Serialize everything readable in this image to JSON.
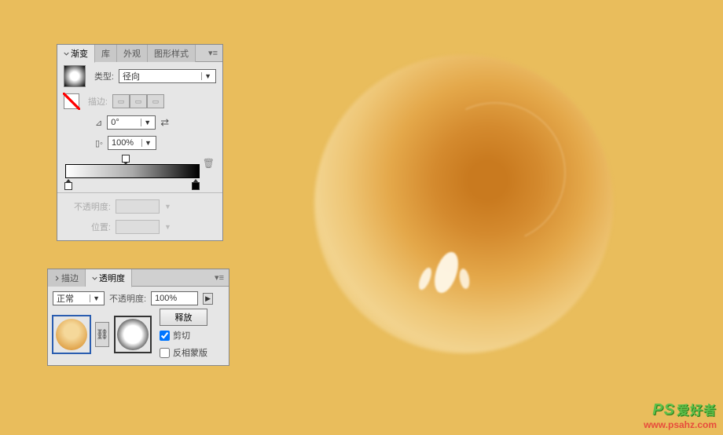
{
  "gradient_panel": {
    "tabs": [
      "渐变",
      "库",
      "外观",
      "图形样式"
    ],
    "active_tab": "渐变",
    "type_label": "类型:",
    "type_value": "径向",
    "stroke_label": "描边:",
    "angle_value": "0°",
    "ratio_value": "100%",
    "opacity_label": "不透明度:",
    "opacity_value": "",
    "position_label": "位置:",
    "position_value": "",
    "menu_glyph": "▾≡"
  },
  "transparency_panel": {
    "tabs": [
      "描边",
      "透明度"
    ],
    "active_tab": "透明度",
    "blend_mode": "正常",
    "opacity_label": "不透明度:",
    "opacity_value": "100%",
    "release_btn": "释放",
    "clip_label": "剪切",
    "clip_checked": true,
    "invert_label": "反相蒙版",
    "invert_checked": false,
    "menu_glyph": "▾≡"
  },
  "watermark": {
    "line1_en": "PS",
    "line1_cn": "爱好者",
    "line2": "www.psahz.com"
  },
  "colors": {
    "bg": "#e9bd5c",
    "orb_dark": "#c97a1f",
    "orb_light": "#f2d38e",
    "highlight": "#fff8e8"
  }
}
